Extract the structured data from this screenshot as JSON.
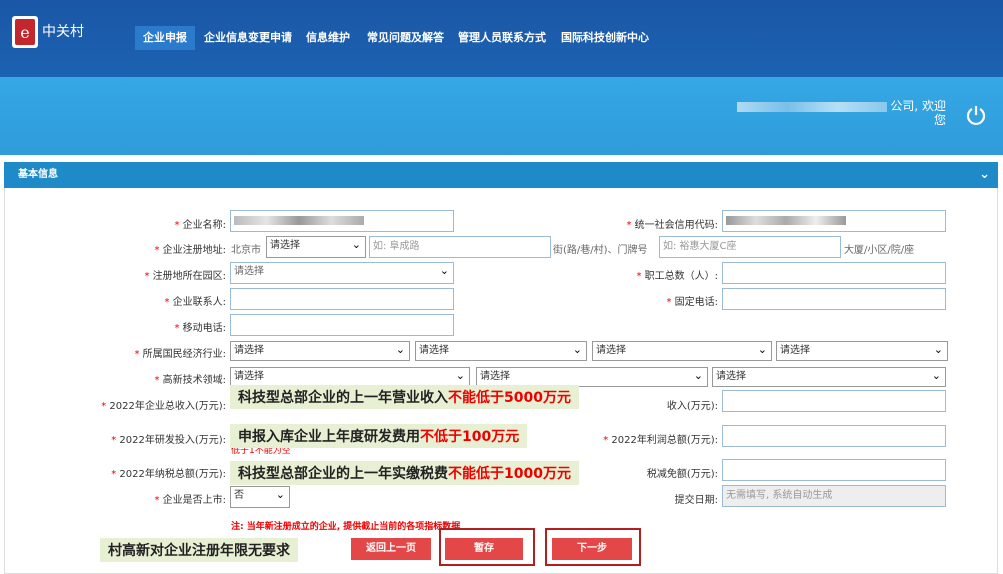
{
  "header": {
    "logo_text": "中关村",
    "nav": [
      "企业申报",
      "企业信息变更申请",
      "信息维护",
      "常见问题及解答",
      "管理人员联系方式",
      "国际科技创新中心"
    ],
    "welcome_line1": "公司, 欢迎",
    "welcome_line2": "您"
  },
  "section": {
    "title": "基本信息"
  },
  "form": {
    "company_name_label": "企业名称:",
    "credit_code_label": "统一社会信用代码:",
    "address_label": "企业注册地址:",
    "address_city": "北京市",
    "address_select": "请选择",
    "address_road_placeholder": "如: 阜成路",
    "address_road_suffix": "街(路/巷/村)、门牌号",
    "address_building_placeholder": "如: 裕惠大厦C座",
    "address_building_suffix": "大厦/小区/院/座",
    "park_label": "注册地所在园区:",
    "park_select": "请选择",
    "employees_label": "职工总数（人）:",
    "contact_label": "企业联系人:",
    "phone_label": "固定电话:",
    "mobile_label": "移动电话:",
    "industry_label": "所属国民经济行业:",
    "industry_selects": [
      "请选择",
      "请选择",
      "请选择",
      "请选择"
    ],
    "tech_label": "高新技术领域:",
    "tech_selects": [
      "请选择",
      "请选择",
      "请选择"
    ],
    "income_label": "2022年企业总收入(万元):",
    "income_right_label": "收入(万元):",
    "rd_label": "2022年研发投入(万元):",
    "rd_warn": "低于1不能为空",
    "profit_label": "2022年利润总额(万元):",
    "tax_label": "2022年纳税总额(万元):",
    "tax_right_label": "税减免额(万元):",
    "listed_label": "企业是否上市:",
    "listed_value": "否",
    "submit_date_label": "提交日期:",
    "submit_date_placeholder": "无需填写, 系统自动生成",
    "footer_note": "注: 当年新注册成立的企业, 提供截止当前的各项指标数据"
  },
  "notes": {
    "n1_pre": "科技型总部企业的上一年营业收入",
    "n1_red": "不能低于5000万元",
    "n2_pre": "申报入库企业上年度研发费用",
    "n2_red": "不低于100万元",
    "n3_pre": "科技型总部企业的上一年实缴税费",
    "n3_red": "不能低于1000万元",
    "n4": "村高新对企业注册年限无要求"
  },
  "buttons": {
    "back": "返回上一页",
    "save": "暂存",
    "next": "下一步"
  },
  "colors": {
    "header": "#1a57a6",
    "banner": "#35a8e5",
    "section": "#1e8bc8",
    "button": "#e34747",
    "required": "#e00000"
  }
}
